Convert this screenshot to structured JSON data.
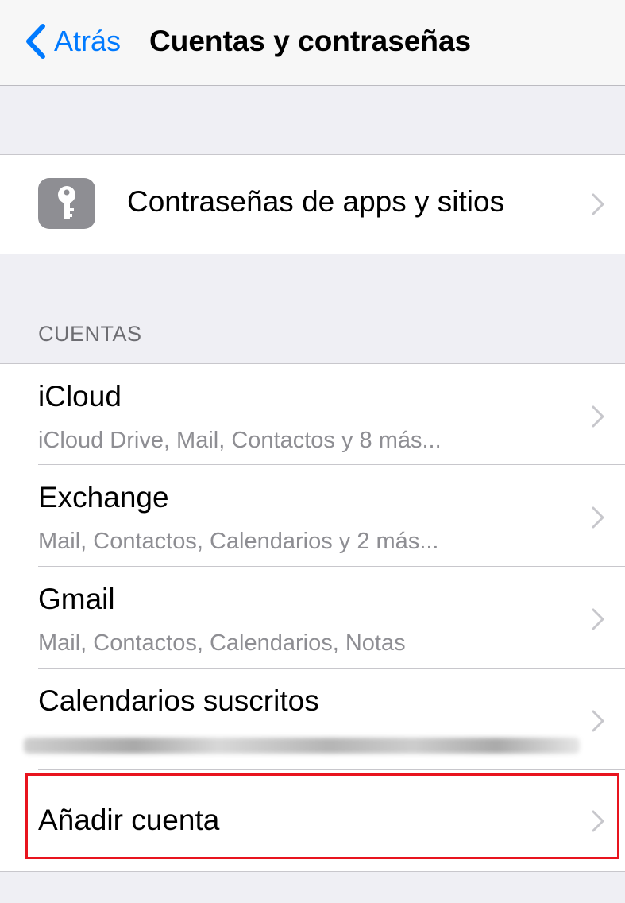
{
  "nav": {
    "back_label": "Atrás",
    "title": "Cuentas y contraseñas"
  },
  "passwords_row": {
    "label": "Contraseñas de apps y sitios",
    "icon": "key-icon"
  },
  "accounts_section": {
    "header": "CUENTAS",
    "items": [
      {
        "title": "iCloud",
        "subtitle": "iCloud Drive, Mail, Contactos y 8 más..."
      },
      {
        "title": "Exchange",
        "subtitle": "Mail, Contactos, Calendarios y 2 más..."
      },
      {
        "title": "Gmail",
        "subtitle": "Mail, Contactos, Calendarios, Notas"
      },
      {
        "title": "Calendarios suscritos",
        "subtitle": ""
      }
    ]
  },
  "add_account": {
    "label": "Añadir cuenta"
  },
  "colors": {
    "accent": "#007aff",
    "highlight_border": "#e8141e",
    "background": "#efeff4"
  }
}
